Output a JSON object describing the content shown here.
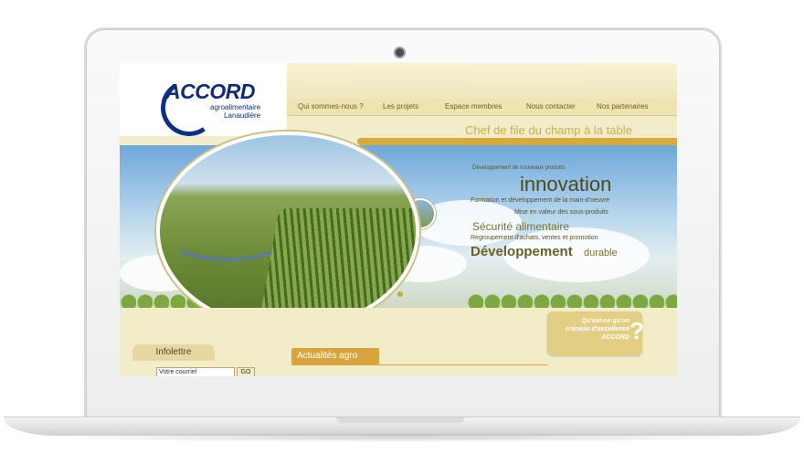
{
  "site": {
    "logo_name": "ACCORD",
    "logo_subtitle_1": "agroalimentaire",
    "logo_subtitle_2": "Lanaudière",
    "slogan": "Chef de file du champ à la table"
  },
  "nav": {
    "items": [
      {
        "label": "Qui sommes-nous ?"
      },
      {
        "label": "Les projets"
      },
      {
        "label": "Espace membres"
      },
      {
        "label": "Nous contacter"
      },
      {
        "label": "Nos partenaires"
      }
    ]
  },
  "banner": {
    "line1": "Développement de nouveaux produits",
    "line2": "innovation",
    "line3": "Formation et développement de la main-d'oeuvre",
    "line4": "Mise en valeur des sous-produits",
    "line5": "Sécurité alimentaire",
    "line6": "Regroupement d'achats, ventes et promotion",
    "line7_a": "Développement",
    "line7_b": "durable"
  },
  "newsletter": {
    "title": "Infolettre",
    "email_placeholder": "Votre courriel",
    "go_label": "GO"
  },
  "news": {
    "title": "Actualités agro"
  },
  "excellence": {
    "line1": "Qu'est-ce qu'un",
    "line2": "créneau d'excellence",
    "line3": "ACCORD",
    "mark": "?"
  },
  "colors": {
    "brand_blue": "#0f2b7a",
    "gold": "#d8a43d",
    "beige": "#f3ecc8",
    "olive_text": "#5a5328"
  }
}
